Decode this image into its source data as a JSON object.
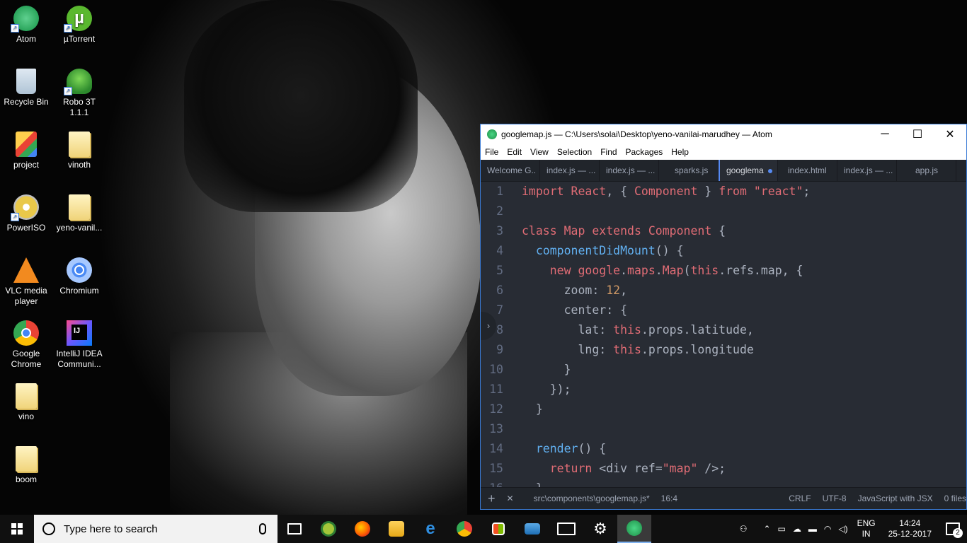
{
  "desktop": {
    "icons": [
      {
        "label": "Atom",
        "icon": "atom-icon"
      },
      {
        "label": "µTorrent",
        "icon": "utorrent-icon"
      },
      {
        "label": "Recycle Bin",
        "icon": "recycle-bin-icon"
      },
      {
        "label": "Robo 3T 1.1.1",
        "icon": "robo3t-icon"
      },
      {
        "label": "project",
        "icon": "folder-icon"
      },
      {
        "label": "vinoth",
        "icon": "folder-icon"
      },
      {
        "label": "PowerISO",
        "icon": "poweriso-icon"
      },
      {
        "label": "yeno-vanil...",
        "icon": "folder-icon"
      },
      {
        "label": "VLC media player",
        "icon": "vlc-icon"
      },
      {
        "label": "Chromium",
        "icon": "chromium-icon"
      },
      {
        "label": "Google Chrome",
        "icon": "chrome-icon"
      },
      {
        "label": "IntelliJ IDEA Communi...",
        "icon": "intellij-icon"
      },
      {
        "label": "vino",
        "icon": "folder-icon"
      },
      {
        "label": "boom",
        "icon": "folder-icon"
      }
    ]
  },
  "atom": {
    "title": "googlemap.js — C:\\Users\\solai\\Desktop\\yeno-vanilai-marudhey — Atom",
    "window_controls": {
      "minimize": "─",
      "maximize": "☐",
      "close": "✕"
    },
    "menu": [
      "File",
      "Edit",
      "View",
      "Selection",
      "Find",
      "Packages",
      "Help"
    ],
    "tabs": [
      {
        "label": "Welcome G..",
        "active": false
      },
      {
        "label": "index.js — ...",
        "active": false
      },
      {
        "label": "index.js — ...",
        "active": false
      },
      {
        "label": "sparks.js",
        "active": false
      },
      {
        "label": "googlema",
        "active": true,
        "modified": true
      },
      {
        "label": "index.html",
        "active": false
      },
      {
        "label": "index.js — ...",
        "active": false
      },
      {
        "label": "app.js",
        "active": false
      }
    ],
    "code": {
      "line_numbers": [
        "1",
        "2",
        "3",
        "4",
        "5",
        "6",
        "7",
        "8",
        "9",
        "10",
        "11",
        "12",
        "13",
        "14",
        "15",
        "16"
      ],
      "lines": [
        "import React, { Component } from \"react\";",
        "",
        "class Map extends Component {",
        "  componentDidMount() {",
        "    new google.maps.Map(this.refs.map, {",
        "      zoom: 12,",
        "      center: {",
        "        lat: this.props.latitude,",
        "        lng: this.props.longitude",
        "      }",
        "    });",
        "  }",
        "",
        "  render() {",
        "    return <div ref=\"map\" />;",
        "  }"
      ]
    },
    "statusbar": {
      "add": "+",
      "close": "✕",
      "path": "src\\components\\googlemap.js*",
      "cursor": "16:4",
      "line_ending": "CRLF",
      "encoding": "UTF-8",
      "grammar": "JavaScript with JSX",
      "files": "0 files"
    },
    "collapse_arrow": "›"
  },
  "taskbar": {
    "search_placeholder": "Type here to search",
    "apps": [
      "task-view",
      "android-studio",
      "firefox",
      "file-explorer",
      "edge",
      "chrome",
      "store",
      "remote-desktop",
      "mail",
      "settings",
      "atom"
    ],
    "tray": {
      "language_line1": "ENG",
      "language_line2": "IN",
      "time": "14:24",
      "date": "25-12-2017",
      "notifications": "2"
    }
  }
}
